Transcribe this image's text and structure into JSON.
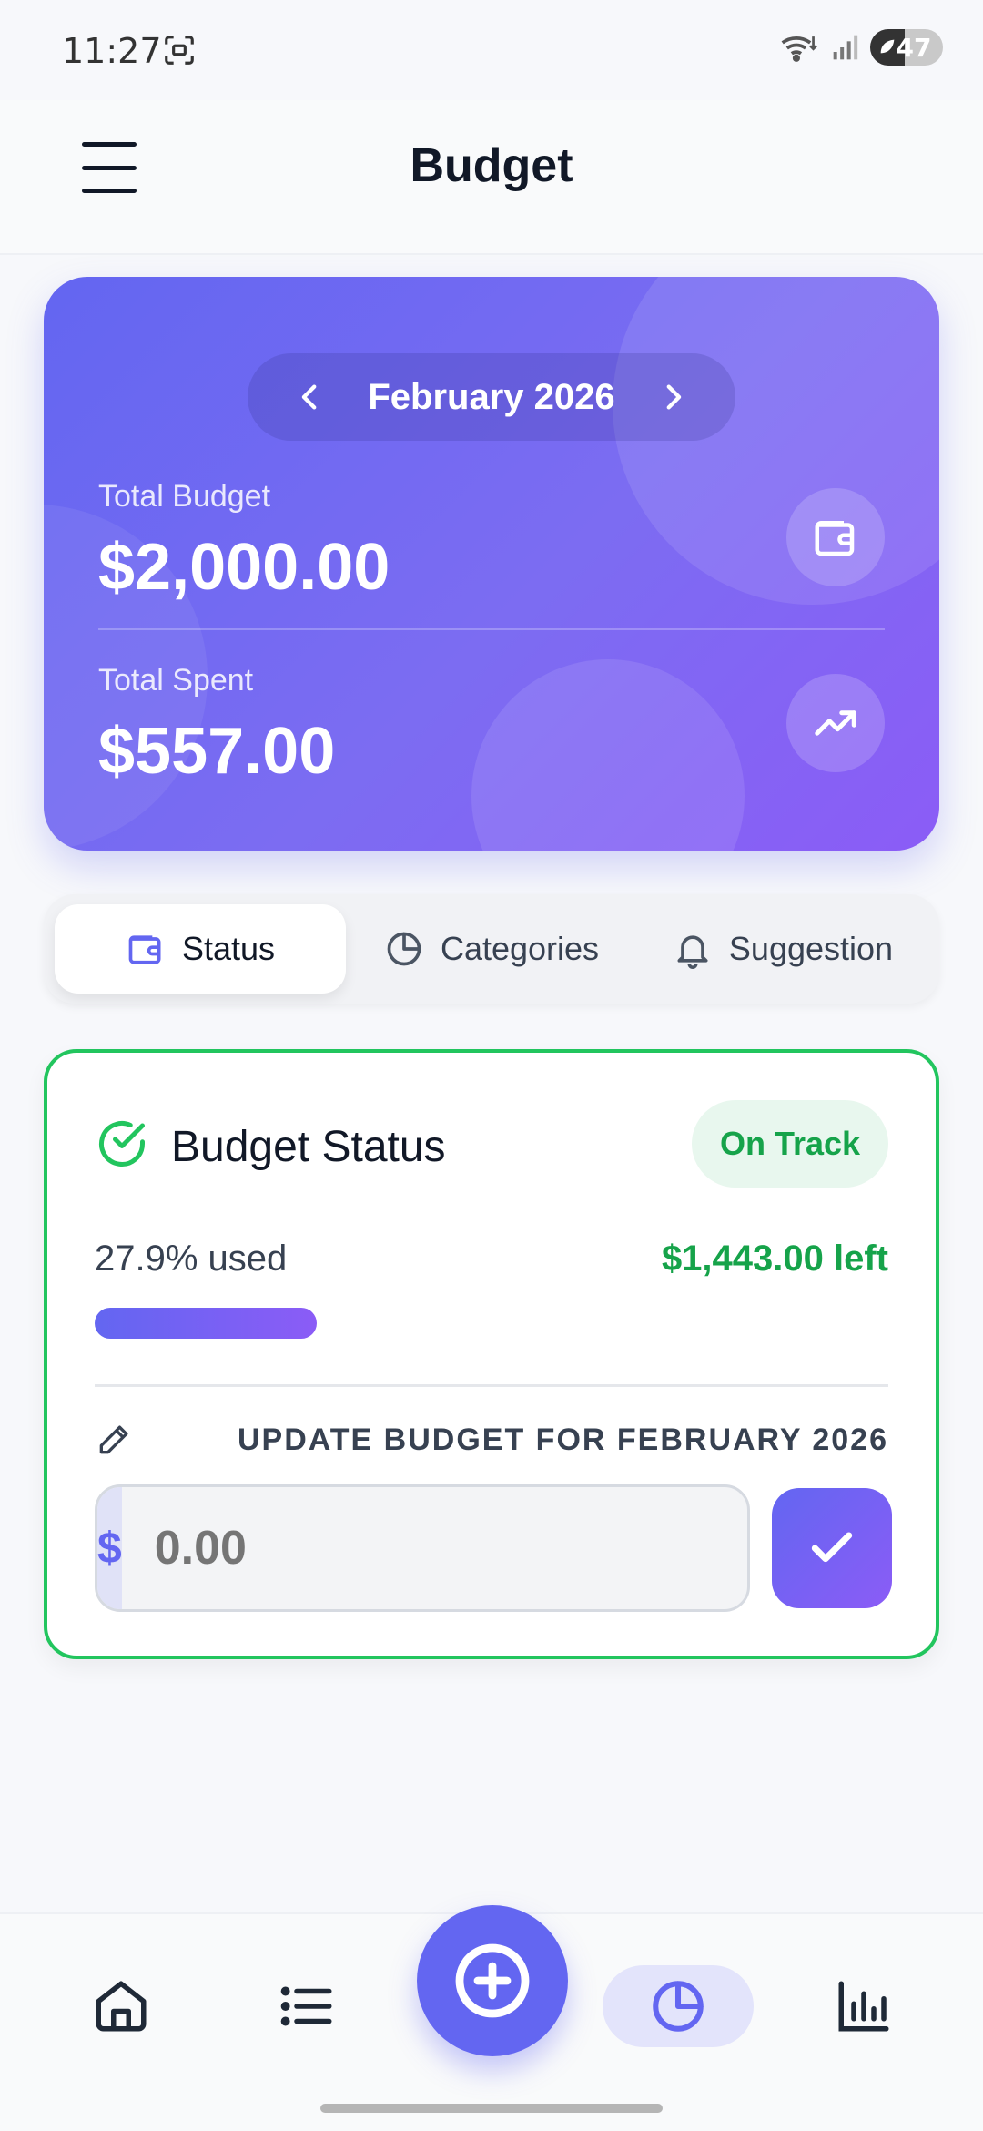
{
  "status_bar": {
    "time": "11:27",
    "battery": "47",
    "icons": [
      "screenshot-icon",
      "wifi-icon",
      "signal-icon",
      "battery-icon"
    ]
  },
  "header": {
    "title": "Budget",
    "menu_icon": "hamburger-menu-icon"
  },
  "summary": {
    "month": "February 2026",
    "total_budget_label": "Total Budget",
    "total_budget": "$2,000.00",
    "total_spent_label": "Total Spent",
    "total_spent": "$557.00"
  },
  "tabs": [
    {
      "label": "Status",
      "icon": "wallet-icon",
      "active": true
    },
    {
      "label": "Categories",
      "icon": "pie-chart-icon",
      "active": false
    },
    {
      "label": "Suggestion",
      "icon": "bell-icon",
      "active": false
    }
  ],
  "status_card": {
    "title": "Budget Status",
    "badge": "On Track",
    "used_text": "27.9% used",
    "used_fraction": 0.279,
    "left_text": "$1,443.00 left",
    "update_label": "UPDATE BUDGET FOR FEBRUARY 2026",
    "currency": "$",
    "input_placeholder": "0.00"
  },
  "bottom_nav": {
    "items": [
      "home-icon",
      "list-icon",
      "add-circle-icon",
      "pie-chart-icon",
      "bar-chart-icon"
    ],
    "active": "pie-chart-icon"
  },
  "colors": {
    "accent": "#6366f1",
    "accent_2": "#8b5cf6",
    "success": "#16a34a",
    "success_border": "#22c55e"
  }
}
